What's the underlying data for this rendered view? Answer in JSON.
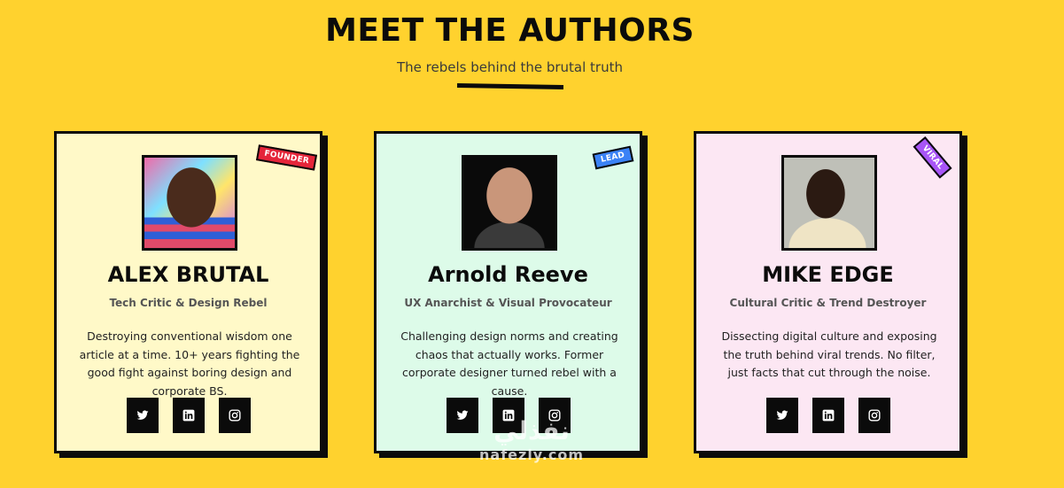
{
  "header": {
    "title": "MEET THE AUTHORS",
    "subtitle": "The rebels behind the brutal truth"
  },
  "colors": {
    "background": "#FFD22E",
    "card_yellow": "#FFF9C8",
    "card_green": "#DDFBE9",
    "card_pink": "#FCE7F3",
    "badge_founder": "#E5253A",
    "badge_lead": "#3B82F6",
    "badge_viral": "#A855F7",
    "ink": "#0B0B0B"
  },
  "authors": [
    {
      "badge": "FOUNDER",
      "name": "ALEX BRUTAL",
      "role": "Tech Critic & Design Rebel",
      "bio": "Destroying conventional wisdom one article at a time. 10+ years fighting the good fight against boring design and corporate BS.",
      "avatar_icon": "avatar-photo",
      "socials": [
        "twitter-icon",
        "linkedin-icon",
        "instagram-icon"
      ]
    },
    {
      "badge": "LEAD",
      "name": "Arnold Reeve",
      "role": "UX Anarchist & Visual Provocateur",
      "bio": "Challenging design norms and creating chaos that actually works. Former corporate designer turned rebel with a cause.",
      "avatar_icon": "avatar-photo",
      "socials": [
        "twitter-icon",
        "linkedin-icon",
        "instagram-icon"
      ]
    },
    {
      "badge": "VIRAL",
      "name": "MIKE EDGE",
      "role": "Cultural Critic & Trend Destroyer",
      "bio": "Dissecting digital culture and exposing the truth behind viral trends. No filter, just facts that cut through the noise.",
      "avatar_icon": "avatar-photo",
      "socials": [
        "twitter-icon",
        "linkedin-icon",
        "instagram-icon"
      ]
    }
  ],
  "watermark": {
    "arabic": "نفذلي",
    "latin": "nafezly.com"
  }
}
